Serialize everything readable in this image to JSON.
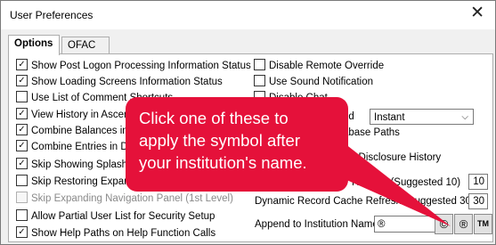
{
  "window": {
    "title": "User Preferences",
    "close_glyph": "✕"
  },
  "tabs": [
    {
      "label": "Options",
      "active": true
    },
    {
      "label": "OFAC",
      "active": false
    }
  ],
  "left_options": [
    {
      "label": "Show Post Logon Processing Information Status",
      "checked": true,
      "enabled": true
    },
    {
      "label": "Show Loading Screens Information Status",
      "checked": true,
      "enabled": true
    },
    {
      "label": "Use List of Comment Shortcuts",
      "checked": false,
      "enabled": true
    },
    {
      "label": "View History in Ascending Order",
      "checked": true,
      "enabled": true
    },
    {
      "label": "Combine Balances in Disclosure",
      "checked": true,
      "enabled": true
    },
    {
      "label": "Combine Entries in Disclosure",
      "checked": true,
      "enabled": true
    },
    {
      "label": "Skip Showing Splash Screen",
      "checked": true,
      "enabled": true
    },
    {
      "label": "Skip Restoring Expanded Navigation Panel",
      "checked": false,
      "enabled": true
    },
    {
      "label": "Skip Expanding Navigation Panel (1st Level)",
      "checked": false,
      "enabled": false
    },
    {
      "label": "Allow Partial User List for Security Setup",
      "checked": false,
      "enabled": true
    },
    {
      "label": "Show Help Paths on Help Function Calls",
      "checked": true,
      "enabled": true
    }
  ],
  "right_options": [
    {
      "label": "Disable Remote Override",
      "checked": false
    },
    {
      "label": "Use Sound Notification",
      "checked": false
    },
    {
      "label": "Disable Chat",
      "checked": false
    }
  ],
  "sound_mode": {
    "label": "nd",
    "value": "Instant"
  },
  "database_paths": {
    "label": "abase Paths"
  },
  "disclosure_history": {
    "label": "ff in Disclosure History"
  },
  "refresh": {
    "label": "Refresh (Suggested 10)",
    "value": "10"
  },
  "dynamic_refresh": {
    "label": "Dynamic Record Cache Refresh (Suggested 30)",
    "value": "30"
  },
  "institution": {
    "label": "Append to Institution Name",
    "value": "®",
    "symbols": [
      "©",
      "®",
      "TM"
    ]
  },
  "callout": {
    "lines": [
      "Click one of these to",
      "apply the symbol after",
      "your institution's name."
    ],
    "color": "#e5113a"
  }
}
